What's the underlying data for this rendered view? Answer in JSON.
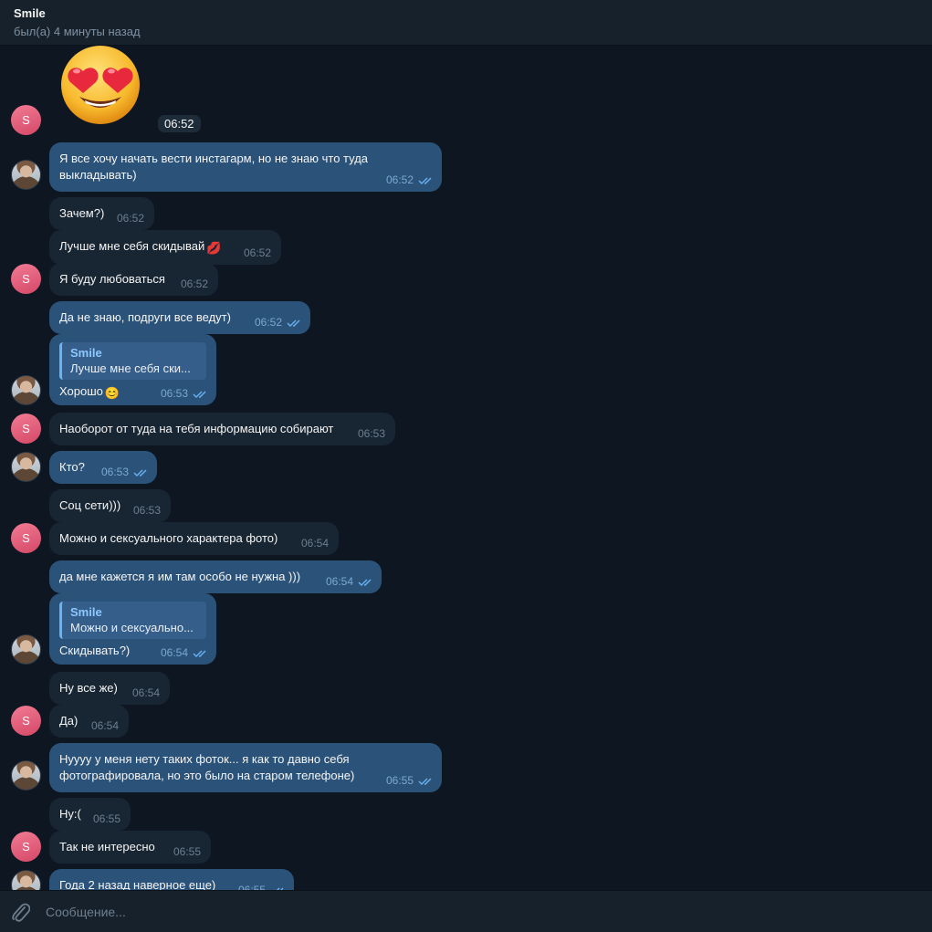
{
  "header": {
    "name": "Smile",
    "status": "был(а) 4 минуты назад"
  },
  "avatars": {
    "contact_letter": "S"
  },
  "sticker": {
    "emoji": "😍",
    "time": "06:52"
  },
  "messages": [
    {
      "text": "Я все хочу начать вести инстагарм, но не знаю что туда выкладывать)",
      "time": "06:52"
    },
    {
      "text": "Зачем?)",
      "time": "06:52"
    },
    {
      "text": "Лучше мне себя скидывай",
      "emoji": "💋",
      "time": "06:52"
    },
    {
      "text": "Я буду любоваться",
      "time": "06:52"
    },
    {
      "text": "Да не знаю, подруги все ведут)",
      "time": "06:52"
    },
    {
      "reply_name": "Smile",
      "reply_text": "Лучше мне себя ски...",
      "text": "Хорошо",
      "emoji": "😊",
      "time": "06:53"
    },
    {
      "text": "Наоборот от туда на тебя информацию собирают",
      "time": "06:53"
    },
    {
      "text": "Кто?",
      "time": "06:53"
    },
    {
      "text": "Соц сети)))",
      "time": "06:53"
    },
    {
      "text": "Можно и сексуального характера фото)",
      "time": "06:54"
    },
    {
      "text": "да мне кажется я им там особо не нужна )))",
      "time": "06:54"
    },
    {
      "reply_name": "Smile",
      "reply_text": "Можно и сексуально...",
      "text": "Скидывать?)",
      "time": "06:54"
    },
    {
      "text": "Ну все же)",
      "time": "06:54"
    },
    {
      "text": "Да)",
      "time": "06:54"
    },
    {
      "text": "Нуууу у меня нету таких фоток... я как то давно себя фотографировала, но это было на старом телефоне)",
      "time": "06:55"
    },
    {
      "text": "Ну:(",
      "time": "06:55"
    },
    {
      "text": "Так не интересно",
      "time": "06:55"
    },
    {
      "text": "Года 2 назад наверное еще)",
      "time": "06:55"
    }
  ],
  "composer": {
    "placeholder": "Сообщение..."
  },
  "colors": {
    "background": "#0e1621",
    "incoming": "#182533",
    "outgoing": "#2b5278",
    "header": "#17212b",
    "accent": "#6ab3f3"
  },
  "icons": {
    "read_ticks": "double-check-icon",
    "attach": "paperclip-icon"
  }
}
